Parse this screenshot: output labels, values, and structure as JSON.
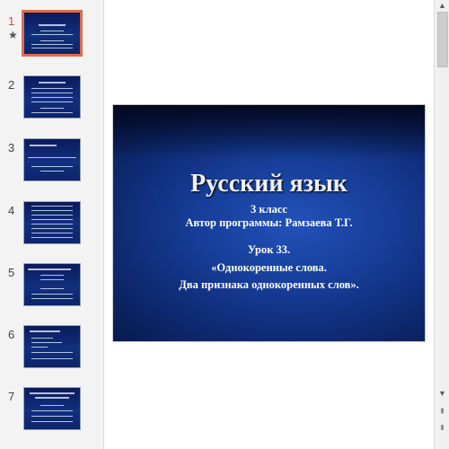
{
  "thumbnails": [
    {
      "number": "1",
      "star": "★"
    },
    {
      "number": "2"
    },
    {
      "number": "3"
    },
    {
      "number": "4"
    },
    {
      "number": "5"
    },
    {
      "number": "6"
    },
    {
      "number": "7"
    }
  ],
  "slide": {
    "title": "Русский язык",
    "line1": "3 класс",
    "line2": "Автор программы: Рамзаева Т.Г.",
    "line3": "Урок 33.",
    "line4": "«Однокоренные слова.",
    "line5": "Два признака однокоренных слов»."
  },
  "scrollbar": {
    "up": "▲",
    "down": "▼",
    "prev": "⇞",
    "next": "⇟"
  },
  "colors": {
    "accent": "#e06c4b",
    "slide_bg": "#173f9b"
  }
}
